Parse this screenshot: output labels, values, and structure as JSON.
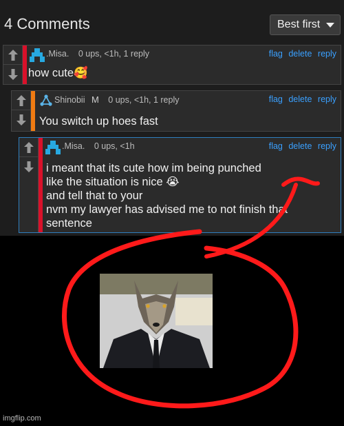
{
  "header": {
    "title": "4 Comments",
    "sort_label": "Best first"
  },
  "comments": [
    {
      "username": ".Misa.",
      "badge": "",
      "stats": "0 ups, <1h, 1 reply",
      "actions": [
        "flag",
        "delete",
        "reply"
      ],
      "lines": [
        "how cute🥰"
      ],
      "bar_color": "#d9112a",
      "avatar_color": "#27a9e1"
    },
    {
      "username": "Shinobii",
      "badge": "M",
      "stats": "0 ups, <1h, 1 reply",
      "actions": [
        "flag",
        "delete",
        "reply"
      ],
      "lines": [
        "You switch up hoes fast"
      ],
      "bar_color": "#f07b12",
      "avatar_color": "#5ab4e8"
    },
    {
      "username": ".Misa.",
      "badge": "",
      "stats": "0 ups, <1h",
      "actions": [
        "flag",
        "delete",
        "reply"
      ],
      "lines": [
        "i meant that its cute how im being punched",
        "like the situation is nice 😭",
        "and tell that to your",
        "nvm my lawyer has advised me to not finish that",
        "sentence"
      ],
      "bar_color": "#d9112a",
      "avatar_color": "#27a9e1"
    }
  ],
  "annotation": {
    "color": "#ff1a1a"
  },
  "watermark": "imgflip.com"
}
